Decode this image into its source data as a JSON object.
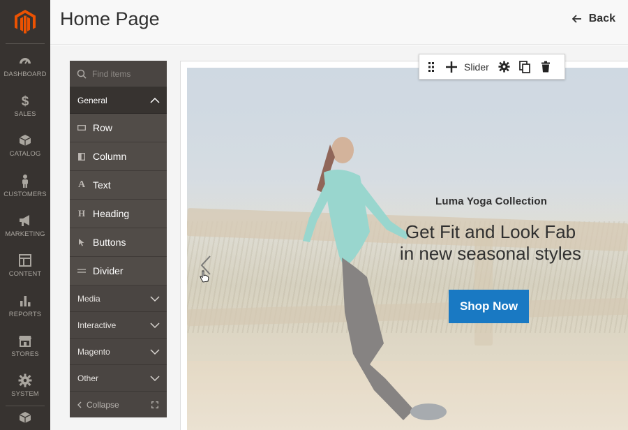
{
  "admin_nav": {
    "items": [
      {
        "label": "DASHBOARD",
        "icon": "dashboard-icon"
      },
      {
        "label": "SALES",
        "icon": "dollar-icon"
      },
      {
        "label": "CATALOG",
        "icon": "cube-icon"
      },
      {
        "label": "CUSTOMERS",
        "icon": "person-icon"
      },
      {
        "label": "MARKETING",
        "icon": "megaphone-icon"
      },
      {
        "label": "CONTENT",
        "icon": "layout-icon"
      },
      {
        "label": "REPORTS",
        "icon": "bar-chart-icon"
      },
      {
        "label": "STORES",
        "icon": "storefront-icon"
      },
      {
        "label": "SYSTEM",
        "icon": "gear-icon"
      }
    ],
    "colors": {
      "bg": "#373330",
      "text": "#aaa69f",
      "logo": "#eb5202"
    }
  },
  "header": {
    "title": "Home Page",
    "back_label": "Back"
  },
  "panel": {
    "search_placeholder": "Find items",
    "general_label": "General",
    "general_items": [
      {
        "label": "Row",
        "icon": "row-icon"
      },
      {
        "label": "Column",
        "icon": "column-icon"
      },
      {
        "label": "Text",
        "icon": "text-icon"
      },
      {
        "label": "Heading",
        "icon": "heading-icon"
      },
      {
        "label": "Buttons",
        "icon": "pointer-icon"
      },
      {
        "label": "Divider",
        "icon": "divider-icon"
      }
    ],
    "sections": [
      "Media",
      "Interactive",
      "Magento",
      "Other"
    ],
    "collapse_label": "Collapse"
  },
  "toolbar": {
    "label": "Slider"
  },
  "slide": {
    "subtitle": "Luma Yoga Collection",
    "headline_line1": "Get Fit and Look Fab",
    "headline_line2": "in new seasonal styles",
    "button_label": "Shop Now",
    "button_color": "#1979c3"
  }
}
